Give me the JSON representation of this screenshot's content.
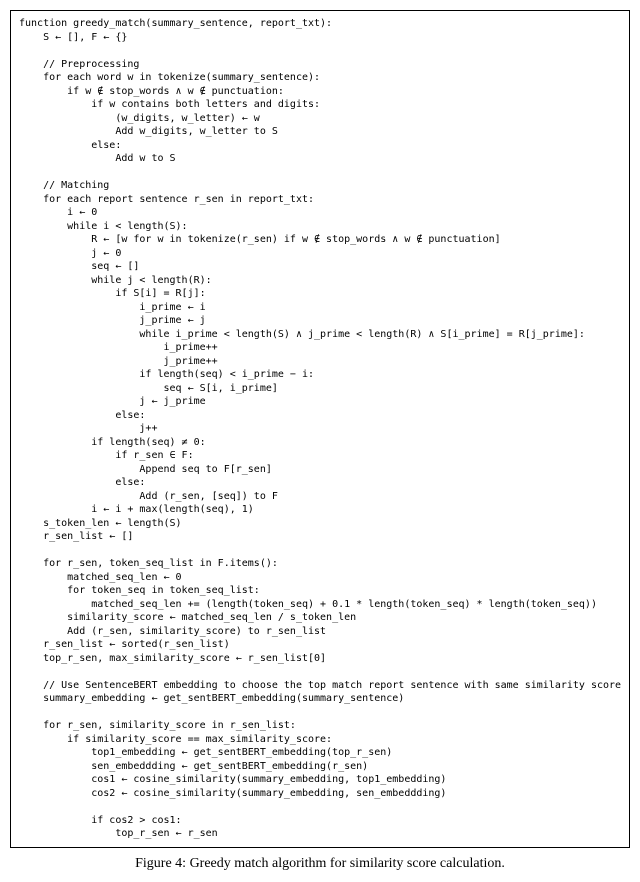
{
  "code": "function greedy_match(summary_sentence, report_txt):\n    S ← [], F ← {}\n\n    // Preprocessing\n    for each word w in tokenize(summary_sentence):\n        if w ∉ stop_words ∧ w ∉ punctuation:\n            if w contains both letters and digits:\n                (w_digits, w_letter) ← w\n                Add w_digits, w_letter to S\n            else:\n                Add w to S\n\n    // Matching\n    for each report sentence r_sen in report_txt:\n        i ← 0\n        while i < length(S):\n            R ← [w for w in tokenize(r_sen) if w ∉ stop_words ∧ w ∉ punctuation]\n            j ← 0\n            seq ← []\n            while j < length(R):\n                if S[i] = R[j]:\n                    i_prime ← i\n                    j_prime ← j\n                    while i_prime < length(S) ∧ j_prime < length(R) ∧ S[i_prime] = R[j_prime]:\n                        i_prime++\n                        j_prime++\n                    if length(seq) < i_prime − i:\n                        seq ← S[i, i_prime]\n                    j ← j_prime\n                else:\n                    j++\n            if length(seq) ≠ 0:\n                if r_sen ∈ F:\n                    Append seq to F[r_sen]\n                else:\n                    Add (r_sen, [seq]) to F\n            i ← i + max(length(seq), 1)\n    s_token_len ← length(S)\n    r_sen_list ← []\n\n    for r_sen, token_seq_list in F.items():\n        matched_seq_len ← 0\n        for token_seq in token_seq_list:\n            matched_seq_len += (length(token_seq) + 0.1 * length(token_seq) * length(token_seq))\n        similarity_score ← matched_seq_len / s_token_len\n        Add (r_sen, similarity_score) to r_sen_list\n    r_sen_list ← sorted(r_sen_list)\n    top_r_sen, max_similarity_score ← r_sen_list[0]\n\n    // Use SentenceBERT embedding to choose the top match report sentence with same similarity score\n    summary_embedding ← get_sentBERT_embedding(summary_sentence)\n\n    for r_sen, similarity_score in r_sen_list:\n        if similarity_score == max_similarity_score:\n            top1_embedding ← get_sentBERT_embedding(top_r_sen)\n            sen_embeddding ← get_sentBERT_embedding(r_sen)\n            cos1 ← cosine_similarity(summary_embedding, top1_embedding)\n            cos2 ← cosine_similarity(summary_embedding, sen_embeddding)\n\n            if cos2 > cos1:\n                top_r_sen ← r_sen",
  "caption": "Figure 4: Greedy match algorithm for similarity score calculation."
}
